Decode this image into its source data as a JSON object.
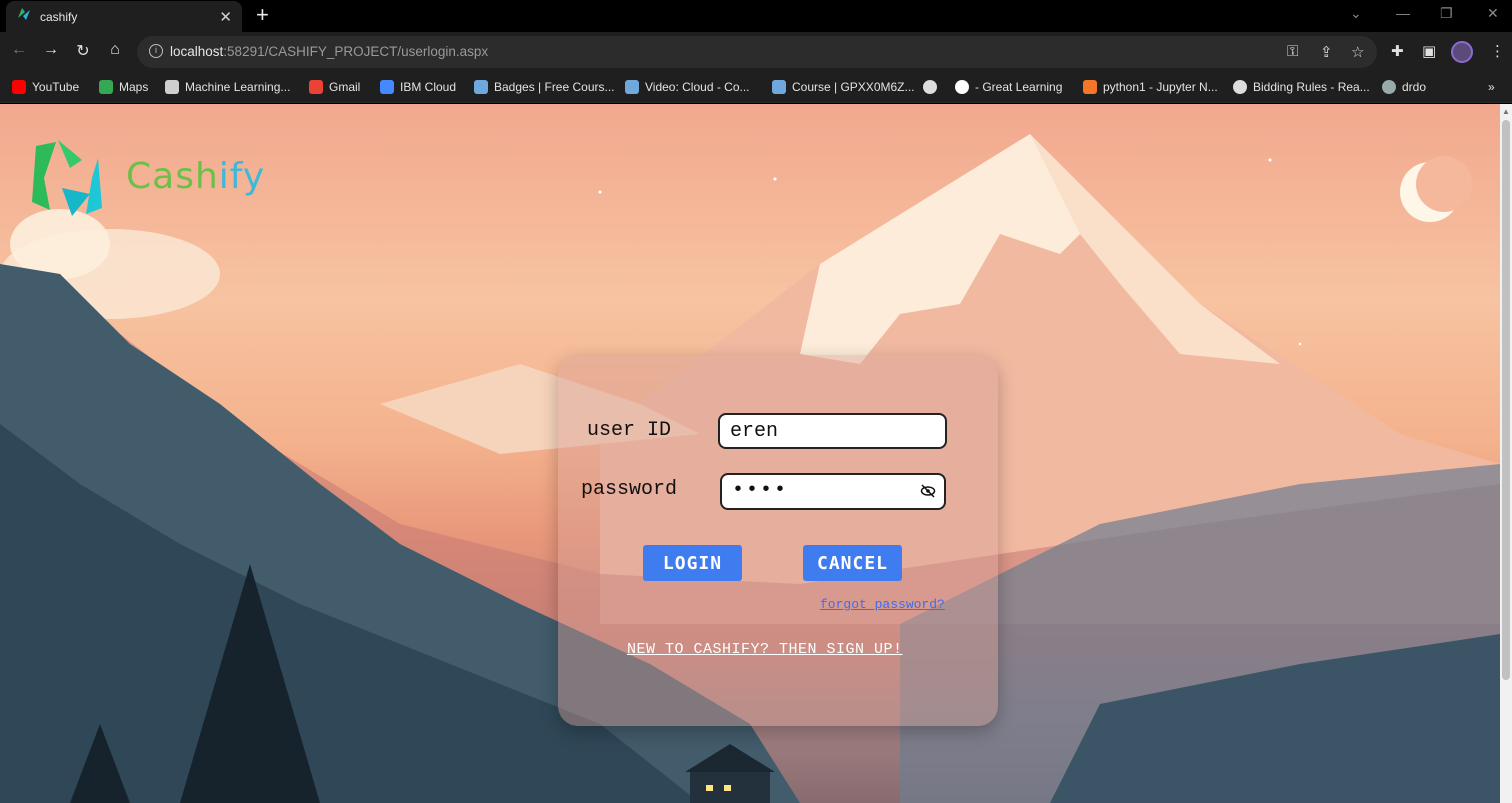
{
  "browser": {
    "tab_title": "cashify",
    "url_host": "localhost",
    "url_rest": ":58291/CASHIFY_PROJECT/userlogin.aspx",
    "bookmarks": [
      {
        "label": "YouTube",
        "icon": "youtube-icon",
        "color": "#ff0000"
      },
      {
        "label": "Maps",
        "icon": "maps-icon",
        "color": "#34a853"
      },
      {
        "label": "Machine Learning...",
        "icon": "ml-icon",
        "color": "#cfcfcf"
      },
      {
        "label": "Gmail",
        "icon": "gmail-icon",
        "color": "#ea4335"
      },
      {
        "label": "IBM Cloud",
        "icon": "ibm-cloud-icon",
        "color": "#4589ff"
      },
      {
        "label": "Badges | Free Cours...",
        "icon": "badge-icon",
        "color": "#6fa8dc"
      },
      {
        "label": "Video: Cloud - Co...",
        "icon": "video-icon",
        "color": "#6fa8dc"
      },
      {
        "label": "Course | GPXX0M6Z...",
        "icon": "course-icon",
        "color": "#6fa8dc"
      },
      {
        "label": "",
        "icon": "globe-icon",
        "color": "#dddddd"
      },
      {
        "label": "- Great Learning",
        "icon": "google-icon",
        "color": "#ffffff"
      },
      {
        "label": "python1 - Jupyter N...",
        "icon": "jupyter-icon",
        "color": "#f37726"
      },
      {
        "label": "Bidding Rules - Rea...",
        "icon": "globe-icon",
        "color": "#dddddd"
      },
      {
        "label": "drdo",
        "icon": "drdo-icon",
        "color": "#9aa"
      }
    ]
  },
  "brand": {
    "name_part1": "Cash",
    "name_part2": "ify",
    "color1": "#6cc04a",
    "color2": "#3fb8d8"
  },
  "login": {
    "userid_label": "user ID",
    "userid_value": "eren",
    "password_label": "password",
    "password_value": "••••",
    "login_button": "LOGIN",
    "cancel_button": "CANCEL",
    "forgot_link": "forgot password?",
    "signup_link": "NEW TO CASHIFY? THEN SIGN UP!",
    "button_color": "#3f7cf0"
  }
}
